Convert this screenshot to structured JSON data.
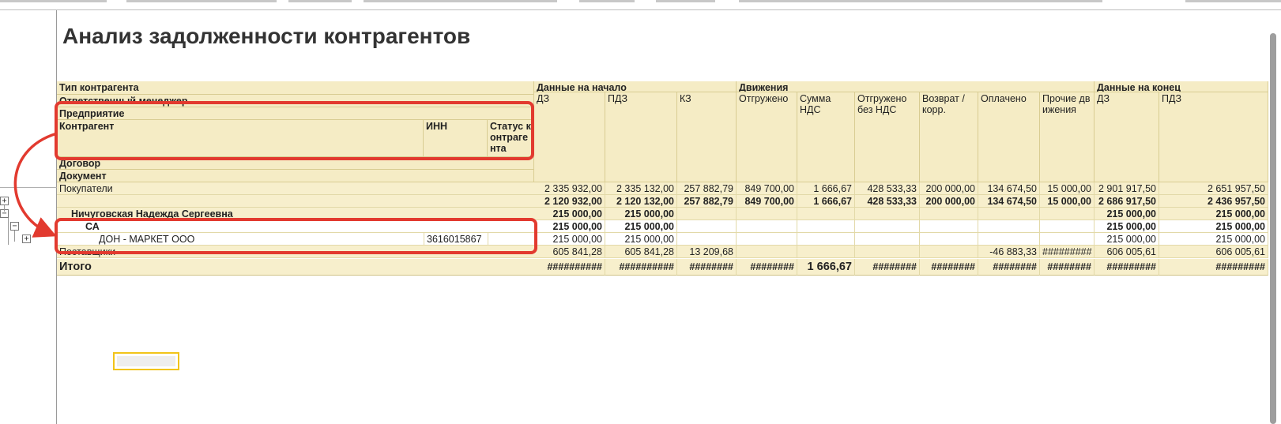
{
  "report": {
    "title": "Анализ задолженности контрагентов"
  },
  "header": {
    "dims": {
      "type": "Тип контрагента",
      "manager": "Ответственный менеджер",
      "enterprise": "Предприятие",
      "counterparty": "Контрагент",
      "inn": "ИНН",
      "status": "Статус контрагента",
      "contract": "Договор",
      "document": "Документ"
    },
    "groups": {
      "start": "Данные на начало",
      "movements": "Движения",
      "end": "Данные на конец"
    },
    "cols": {
      "dz": "ДЗ",
      "pdz": "ПДЗ",
      "kz": "КЗ",
      "shipped": "Отгружено",
      "vat": "Сумма НДС",
      "shipped_novat": "Отгружено без НДС",
      "return": "Возврат / корр.",
      "paid": "Оплачено",
      "other": "Прочие движения",
      "end_dz": "ДЗ",
      "end_pdz": "ПДЗ"
    }
  },
  "rows": [
    {
      "label": "Покупатели",
      "inn": "",
      "values": [
        "2 335 932,00",
        "2 335 132,00",
        "257 882,79",
        "849 700,00",
        "1 666,67",
        "428 533,33",
        "200 000,00",
        "134 674,50",
        "15 000,00",
        "2 901 917,50",
        "2 651 957,50"
      ]
    },
    {
      "label": "",
      "inn": "",
      "values": [
        "2 120 932,00",
        "2 120 132,00",
        "257 882,79",
        "849 700,00",
        "1 666,67",
        "428 533,33",
        "200 000,00",
        "134 674,50",
        "15 000,00",
        "2 686 917,50",
        "2 436 957,50"
      ]
    },
    {
      "label": "Ничуговская Надежда Сергеевна",
      "inn": "",
      "values": [
        "215 000,00",
        "215 000,00",
        "",
        "",
        "",
        "",
        "",
        "",
        "",
        "215 000,00",
        "215 000,00"
      ]
    },
    {
      "label": "СА",
      "inn": "",
      "values": [
        "215 000,00",
        "215 000,00",
        "",
        "",
        "",
        "",
        "",
        "",
        "",
        "215 000,00",
        "215 000,00"
      ]
    },
    {
      "label": "ДОН - МАРКЕТ ООО",
      "inn": "3616015867",
      "values": [
        "215 000,00",
        "215 000,00",
        "",
        "",
        "",
        "",
        "",
        "",
        "",
        "215 000,00",
        "215 000,00"
      ]
    },
    {
      "label": "Поставщики",
      "inn": "",
      "values": [
        "605 841,28",
        "605 841,28",
        "13 209,68",
        "",
        "",
        "",
        "",
        "-46 883,33",
        "#########",
        "606 005,61",
        "606 005,61"
      ]
    }
  ],
  "total": {
    "label": "Итого",
    "values": [
      "##########",
      "##########",
      "########",
      "########",
      "1 666,67",
      "########",
      "########",
      "########",
      "########",
      "#########",
      "#########"
    ]
  },
  "tree": {
    "expand_symbol": "+",
    "collapse_symbol": "−"
  },
  "colors": {
    "header_bg": "#f5ecc5",
    "annotation_red": "#e23a2f",
    "selection": "#f2c41a"
  }
}
